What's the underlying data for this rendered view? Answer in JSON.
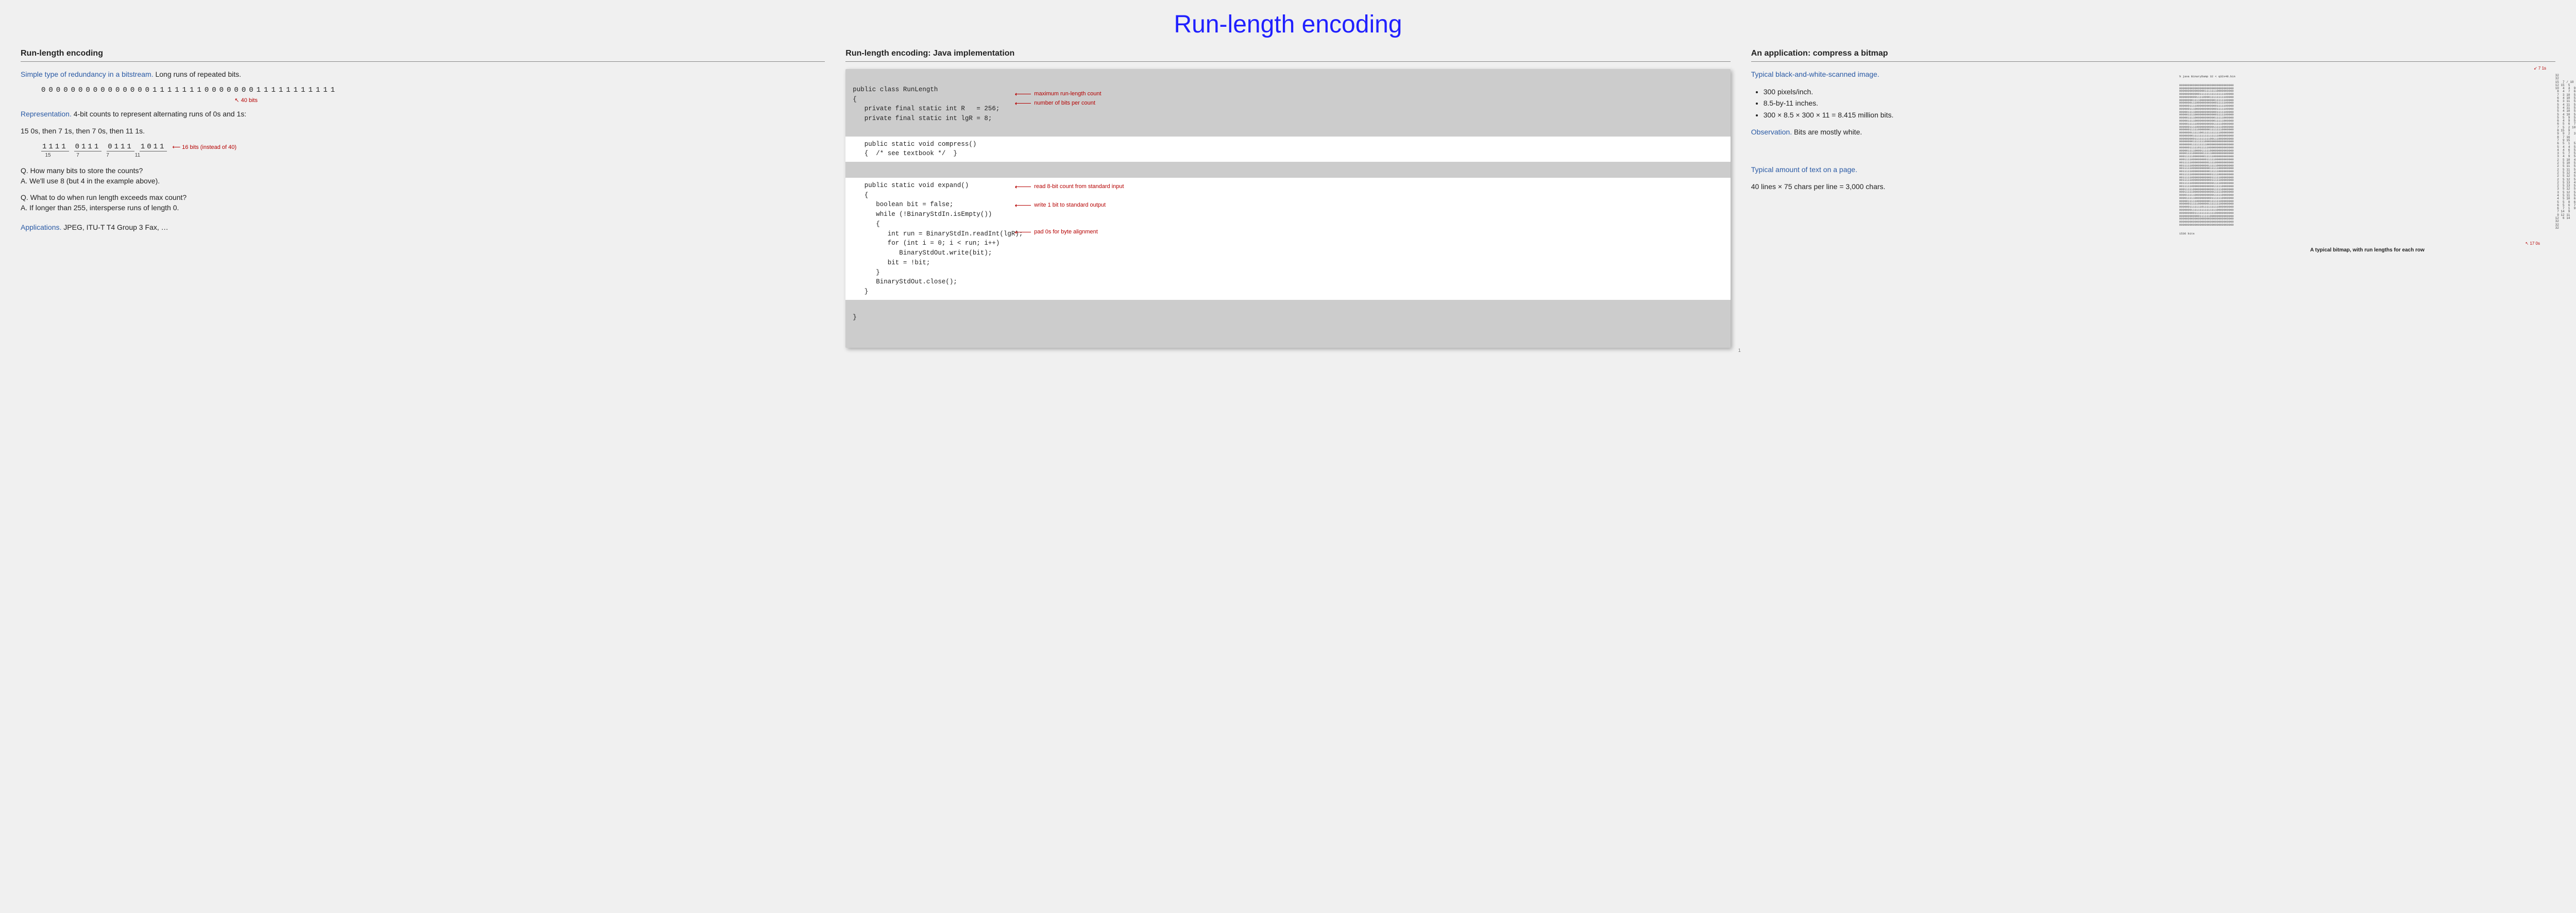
{
  "main_title": "Run-length encoding",
  "left": {
    "heading": "Run-length encoding",
    "intro_label": "Simple type of redundancy in a bitstream.",
    "intro_text": " Long runs of repeated bits.",
    "bitstring": "0000000000000001111111000000011111111111",
    "note40": "40 bits",
    "repr_label": "Representation.",
    "repr_text": " 4-bit counts to represent alternating runs of 0s and 1s:",
    "repr_example": "15 0s, then 7 1s, then 7 0s, then 11 1s.",
    "nibbles": [
      "1111",
      "0111",
      "0111",
      "1011"
    ],
    "nibble_labels": [
      "15",
      "7",
      "7",
      "11"
    ],
    "nibble_note": "16 bits (instead of 40)",
    "q1_q": "Q.  How many bits to store the counts?",
    "q1_a": "A.  We'll use 8 (but 4 in the example above).",
    "q2_q": "Q.  What to do when run length exceeds max count?",
    "q2_a": "A.  If longer than 255, intersperse runs of length 0.",
    "apps_label": "Applications.",
    "apps_text": " JPEG, ITU-T T4 Group 3 Fax, …"
  },
  "mid": {
    "heading": "Run-length encoding:  Java implementation",
    "code_top": "public class RunLength\n{\n   private final static int R   = 256;\n   private final static int lgR = 8;",
    "code_compress": "   public static void compress()\n   {  /* see textbook */  }",
    "code_expand": "   public static void expand()\n   {\n      boolean bit = false;\n      while (!BinaryStdIn.isEmpty())\n      {\n         int run = BinaryStdIn.readInt(lgR);\n         for (int i = 0; i < run; i++)\n            BinaryStdOut.write(bit);\n         bit = !bit;\n      }\n      BinaryStdOut.close();\n   }",
    "code_close": "}",
    "annot1": "maximum run-length count",
    "annot2": "number of bits per count",
    "annot3": "read 8-bit count from standard input",
    "annot4": "write 1 bit to standard output",
    "annot5": "pad 0s for byte alignment",
    "page_num": "1"
  },
  "right": {
    "heading": "An application:  compress a bitmap",
    "typ_label": "Typical black-and-white-scanned image.",
    "bullets": [
      "300 pixels/inch.",
      "8.5-by-11 inches.",
      "300 × 8.5 × 300 × 11 = 8.415 million bits."
    ],
    "obs_label": "Observation.",
    "obs_text": " Bits are mostly white.",
    "text_label": "Typical amount of text on a page.",
    "text_calc": "40 lines × 75 chars per line = 3,000 chars.",
    "dump_cmd": "% java BinaryDump 32 < q32x48.bin",
    "bitmap_rows": [
      "00000000000000000000000000000000",
      "00000000000000000000000000000000",
      "00000000000000011111110000000000",
      "00000000000011111111111111100000",
      "00000000001111000011111111100000",
      "00000000111100000000011111100000",
      "00000001110000000000001111100000",
      "00000011110000000000001111100000",
      "00000011100000000000001111100000",
      "00000111100000000000001111100000",
      "00000111100000000000001111100000",
      "00000111100000000000011111000000",
      "00000111100000000000011111000000",
      "00000111110000000000111110000000",
      "00000011110000000000111110000000",
      "00000011111000000011111110000000",
      "00000001111100111111111100000000",
      "00000000111111111111111000000000",
      "00000000011111111100111000000000",
      "00000000111111100000000000000000",
      "00000001111111110000000000000000",
      "00000011111011111000000000000000",
      "00000111100001111100000000000000",
      "00001111000000111110000000000000",
      "00011111000000011111000000000000",
      "00011110000000001111100000000000",
      "00111110000000000111100000000000",
      "00111110000000000111110000000000",
      "00111110000000000011111000000000",
      "00111110000000000011111000000000",
      "00111110000000000001111000000000",
      "00111110000000000001111100000000",
      "00111110000000000001111100000000",
      "00111110000000000000111100000000",
      "00111110000000000000111110000000",
      "00011111000000000000111110000000",
      "00011111000000000000111110000000",
      "00001111100000000000111110000000",
      "00001111100000000001111110000000",
      "00000111110000000011111100000000",
      "00000011111000000111111100000000",
      "00000011111110111111111000000000",
      "00000001111111111111110000000000",
      "00000000011111111111100000000000",
      "00000000000011111100000000000000",
      "00000000000000000000000000000000",
      "00000000000000000000000000000000",
      "00000000000000000000000000000000"
    ],
    "bitmap_footer": "1536 bits",
    "run_lengths": "32\n32\n15  7 / 10\n12 15  5\n10  4  4  9  5\n 8  4  7  6  5\n 7  3 10  5  5\n 6  4 10  5  5\n 6  3 11  5  5\n 5  4 11  5  5\n 5  4 11  5  5\n 5  4 10  5  6\n 5  4 10  5  6\n 5  5  9  5  7\n 6  4  9  5  7\n 6  5  6  7  7\n 7  5  2 10  8\n 8 15  9\n 9  9  2  3  9\n 8  7 16\n 7  9 15\n 6  5  1  5 14\n 5  4  4  5 13\n 4  4  6  5 12\n 3  5  7  5 11\n 3  4  9  5 10\n 2  5 10  4 10\n 2  5 10  5  9\n 2  5 11  5  9\n 2  5 11  5  9\n 2  5 12  4  9\n 2  5 12  5  8\n 2  5 12  5  8\n 2  5 13  4  8\n 2  5 13  5  7\n 3  5 12  5  7\n 3  5 12  5  7\n 4  5 11  5  7\n 4  5 10  6  7\n 5  5  8  6  8\n 6  5  6  7  8\n 6  7  1  9  9\n 7 14  9\n 9 12 11\n12  6 14\n32\n32\n32",
    "top_annot": "7 1s",
    "bottom_annot": "17 0s",
    "caption": "A typical bitmap, with run lengths for each row"
  }
}
